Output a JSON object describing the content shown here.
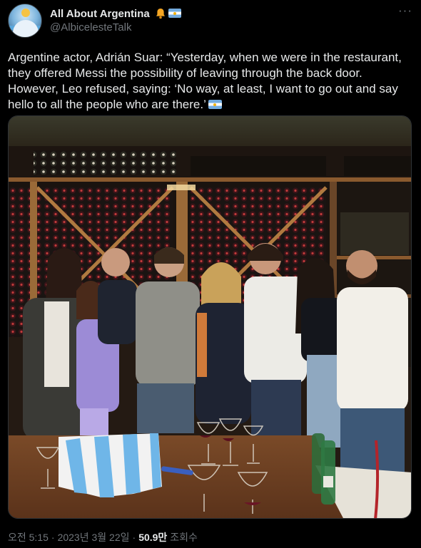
{
  "author": {
    "display_name": "All About Argentina",
    "handle": "@AlbicelesteTalk",
    "badges": [
      "bell-icon",
      "argentina-flag-icon"
    ]
  },
  "tweet": {
    "text": "Argentine actor, Adrián Suar: “Yesterday, when we were in the restaurant, they offered Messi the possibility of leaving through the back door. However, Leo refused, saying: ‘No way, at least, I want to go out and say hello to all the people who are there.’",
    "text_trailing_icon": "argentina-flag-icon"
  },
  "media": {
    "alt_icon": "photo",
    "description_colors": {
      "wall": "#2a1f17",
      "wood": "#8a5a2e",
      "table": "#6e3f22",
      "jersey_blue": "#6fb6e8"
    }
  },
  "meta": {
    "time": "오전 5:15",
    "separator": "·",
    "date": "2023년 3월 22일",
    "views_count": "50.9만",
    "views_label": "조회수"
  },
  "colors": {
    "background": "#000000",
    "text_primary": "#e7e9ea",
    "text_secondary": "#71767b",
    "border": "#2f3336"
  }
}
